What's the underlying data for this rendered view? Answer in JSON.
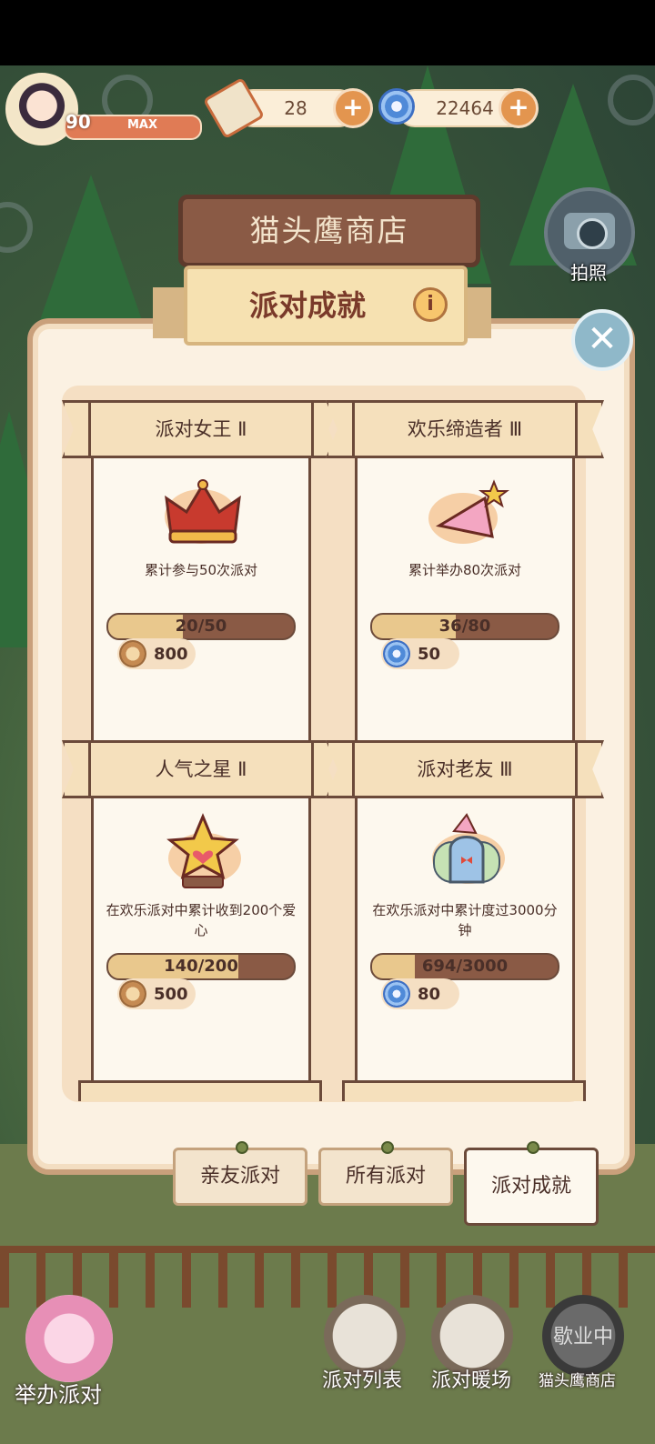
{
  "player": {
    "level": "90",
    "level_tag": "MAX"
  },
  "resources": {
    "tickets": "28",
    "gems": "22464"
  },
  "shop_sign": "猫头鹰商店",
  "panel_title": "派对成就",
  "camera_label": "拍照",
  "achievements": [
    {
      "title": "派对女王 Ⅱ",
      "desc": "累计参与50次派对",
      "progress_text": "20/50",
      "progress": 0.4,
      "reward_type": "coin",
      "reward": "800",
      "icon": "crown-icon"
    },
    {
      "title": "欢乐缔造者 Ⅲ",
      "desc": "累计举办80次派对",
      "progress_text": "36/80",
      "progress": 0.45,
      "reward_type": "gem",
      "reward": "50",
      "icon": "party-hat-icon"
    },
    {
      "title": "人气之星 Ⅱ",
      "desc": "在欢乐派对中累计收到200个爱心",
      "progress_text": "140/200",
      "progress": 0.7,
      "reward_type": "coin",
      "reward": "500",
      "icon": "star-trophy-icon"
    },
    {
      "title": "派对老友 Ⅲ",
      "desc": "在欢乐派对中累计度过3000分钟",
      "progress_text": "694/3000",
      "progress": 0.23,
      "reward_type": "gem",
      "reward": "80",
      "icon": "ghost-friend-icon"
    }
  ],
  "tabs": [
    {
      "label": "亲友派对",
      "active": false
    },
    {
      "label": "所有派对",
      "active": false
    },
    {
      "label": "派对成就",
      "active": true
    }
  ],
  "bottom_nav": {
    "host": "举办派对",
    "list": "派对列表",
    "warmup": "派对暖场",
    "owl_shop": "猫头鹰商店",
    "owl_shop_status": "歇业中"
  },
  "colors": {
    "accent": "#e3954f",
    "panel": "#fbf1e2",
    "title": "#7a3a2a"
  }
}
